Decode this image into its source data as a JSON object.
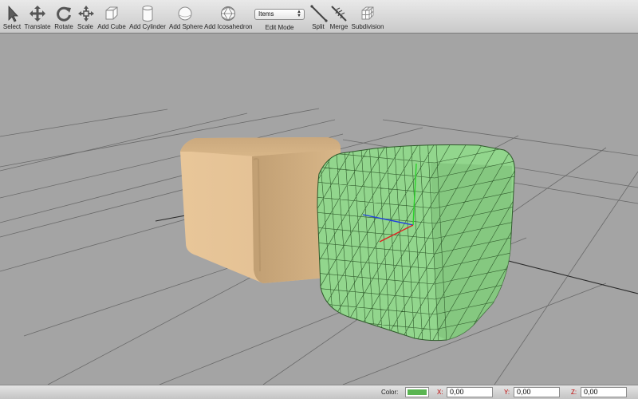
{
  "toolbar": {
    "tools": [
      {
        "label": "Select",
        "icon": "select-arrow-icon"
      },
      {
        "label": "Translate",
        "icon": "translate-arrows-icon"
      },
      {
        "label": "Rotate",
        "icon": "rotate-icon"
      },
      {
        "label": "Scale",
        "icon": "scale-icon"
      },
      {
        "label": "Add Cube",
        "icon": "cube-icon"
      },
      {
        "label": "Add Cylinder",
        "icon": "cylinder-icon"
      },
      {
        "label": "Add Sphere",
        "icon": "sphere-icon"
      },
      {
        "label": "Add Icosahedron",
        "icon": "icosahedron-icon"
      },
      {
        "label": "Split",
        "icon": "split-icon"
      },
      {
        "label": "Merge",
        "icon": "merge-icon"
      },
      {
        "label": "Subdivision",
        "icon": "subdivision-icon"
      }
    ],
    "edit_mode": {
      "value": "Items",
      "label": "Edit Mode"
    }
  },
  "viewport": {
    "objects": [
      {
        "name": "cube",
        "color": "#ddb98c"
      },
      {
        "name": "subdivided cube",
        "color": "#8fd48a",
        "wireframe": true
      }
    ],
    "gizmo_colors": {
      "x": "#e02020",
      "y": "#2bd12b",
      "z": "#2040e0"
    }
  },
  "statusbar": {
    "color_label": "Color:",
    "color_value": "#5ab552",
    "x_label": "X:",
    "x_value": "0,00",
    "y_label": "Y:",
    "y_value": "0,00",
    "z_label": "Z:",
    "z_value": "0,00"
  }
}
